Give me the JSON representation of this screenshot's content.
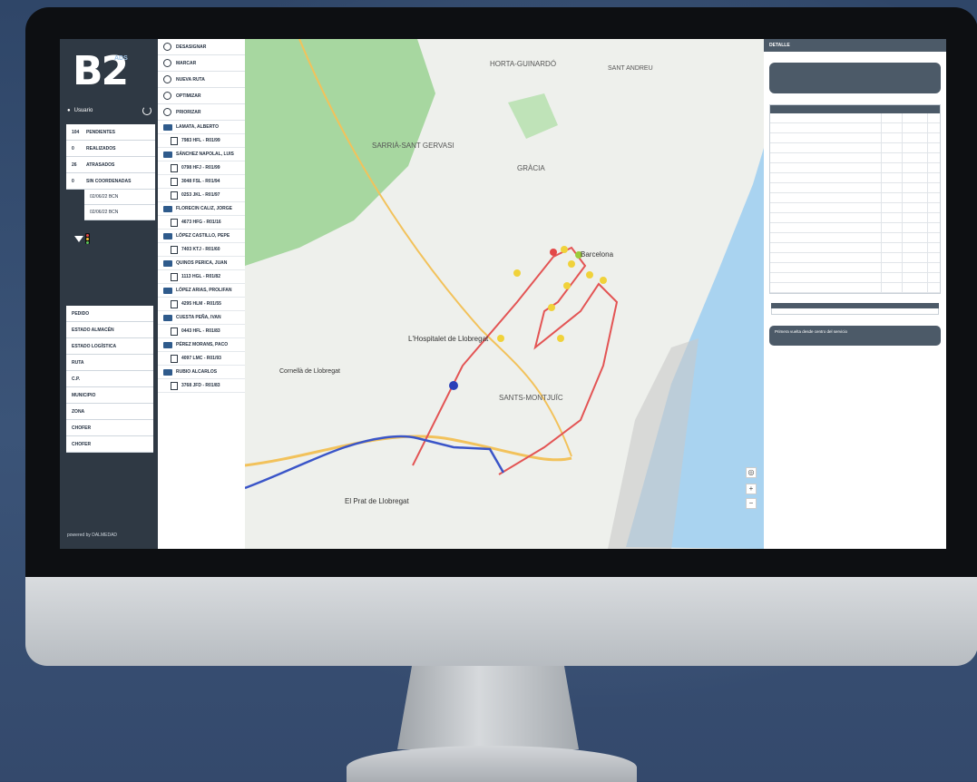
{
  "sidebar": {
    "logo_letters": "B2",
    "logo_sub": "ADS",
    "user": "Usuario",
    "filters": [
      {
        "count": "104",
        "label": "PENDIENTES"
      },
      {
        "count": "0",
        "label": "REALIZADOS"
      },
      {
        "count": "26",
        "label": "ATRASADOS"
      },
      {
        "count": "0",
        "label": "SIN COORDENADAS"
      }
    ],
    "sub_rows": [
      "02/06/22 BCN",
      "02/06/22 BCN"
    ],
    "buttons": [
      "PEDIDO",
      "ESTADO ALMACÉN",
      "ESTADO LOGÍSTICA",
      "RUTA",
      "C.P.",
      "MUNICIPIO",
      "ZONA",
      "CHOFER",
      "CHOFER"
    ],
    "powered": "powered by DALMEDAD"
  },
  "route_list": {
    "actions": [
      "DESASIGNAR",
      "MARCAR",
      "NUEVA RUTA",
      "OPTIMIZAR",
      "PRIORIZAR"
    ],
    "drivers": [
      {
        "name": "LAMATA, ALBERTO",
        "plates": [
          "7983 HFL - R01/99"
        ]
      },
      {
        "name": "SÁNCHEZ NAPOLAL, LUIS",
        "plates": [
          "0798 HFJ - R01/99",
          "3048 FSL - R01/94",
          "0253 JKL - R01/97"
        ]
      },
      {
        "name": "FLORECIN CALIZ, JORGE",
        "plates": [
          "4673 HFG - R01/16"
        ]
      },
      {
        "name": "LÓPEZ CASTILLO, PEPE",
        "plates": [
          "7403 KTJ - R01/60"
        ]
      },
      {
        "name": "QUINOS PERICA, JUAN",
        "plates": [
          "1113 HGL - R01/82"
        ]
      },
      {
        "name": "LÓPEZ ARIAS, PROLIFAN",
        "plates": [
          "4295 HLM - R01/55"
        ]
      },
      {
        "name": "CUESTA PEÑA, IVAN",
        "plates": [
          "0443 HFL - R01/83"
        ]
      },
      {
        "name": "PÉREZ MORANS, PACO",
        "plates": [
          "4097 LMC - R01/93"
        ]
      },
      {
        "name": "RUBIO ALCARLOS",
        "plates": [
          "3768 JFD - R01/83"
        ]
      }
    ]
  },
  "map": {
    "places": [
      "HORTA-GUINARDÓ",
      "SANT ANDREU",
      "SARRIÀ-SANT GERVASI",
      "GRÀCIA",
      "Barcelona",
      "L'Hospitalet de Llobregat",
      "Cornellà de Llobregat",
      "SANTS-MONTJUÏC",
      "El Prat de Llobregat"
    ],
    "colors": {
      "water": "#a9d3f0",
      "green": "#a7d7a0",
      "land": "#eef0ec",
      "red_route": "#e35454",
      "blue_route": "#3a55c8"
    }
  },
  "right_panel": {
    "title": "DETALLE",
    "note": "Primera vuelta desde centro del servicio"
  }
}
